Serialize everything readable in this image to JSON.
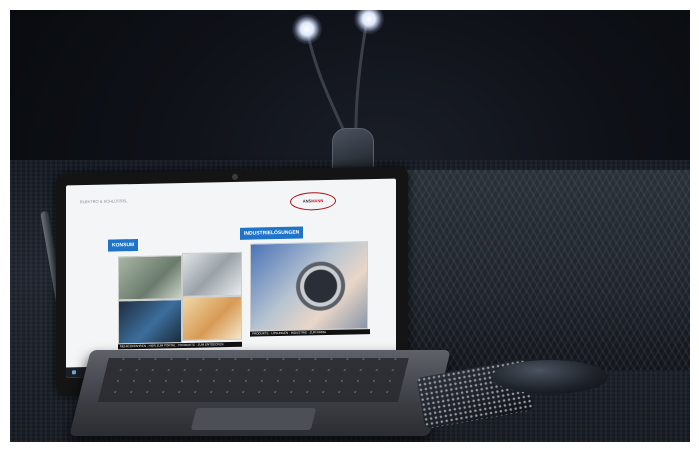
{
  "photo": {
    "description_tag": "",
    "laptop_screen": {
      "site_header": "ELEKTRO & SCHLÜSSEL",
      "logo_text_left": "ANS",
      "logo_text_right": "MANN",
      "tag_left": "KONSUM",
      "tag_right": "INDUSTRIELÖSUNGEN",
      "caption_left": "MEHR ERFAHREN · HIER ZUM PORTAL · PRODUKTE · ZUM ENTDECKEN",
      "caption_right": "PRODUKTE · LÖSUNGEN · INDUSTRIE · ZUR FIRMA"
    },
    "colors": {
      "accent": "#1e74c9",
      "logo_red": "#c01a1a",
      "background": "#0e1117"
    },
    "icons": [
      "lamp-light-icon",
      "lamp-light-icon",
      "clip-lamp-icon"
    ]
  }
}
